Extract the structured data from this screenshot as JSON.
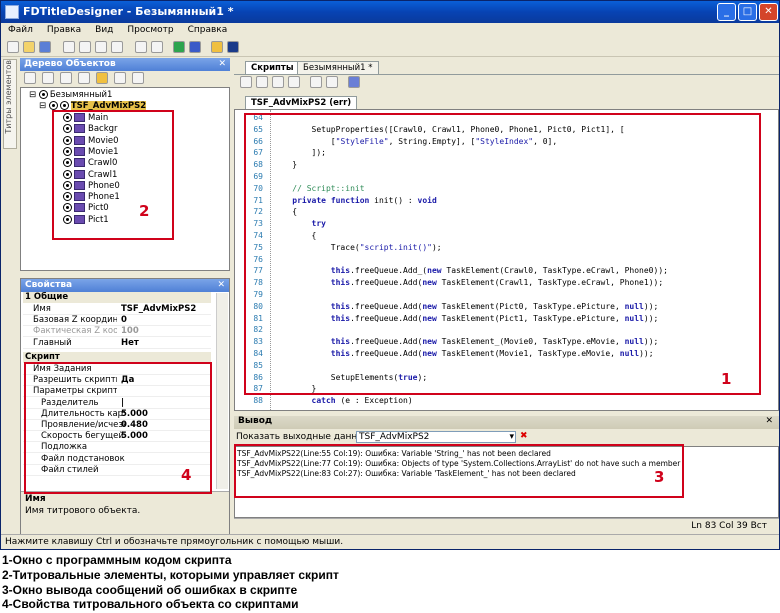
{
  "app": {
    "title": "FDTitleDesigner - Безымянный1 *"
  },
  "menu": [
    "Файл",
    "Правка",
    "Вид",
    "Просмотр",
    "Справка"
  ],
  "tree_panel": {
    "title": "Дерево Объектов",
    "side_tab": "Титры элементов",
    "root": "Безымянный1",
    "child": "TSF_AdvMixPS2",
    "items": [
      "Main",
      "Backgr",
      "Movie0",
      "Movie1",
      "Crawl0",
      "Crawl1",
      "Phone0",
      "Phone1",
      "Pict0",
      "Pict1"
    ]
  },
  "props_panel": {
    "title": "Свойства",
    "group1": "1 Общие",
    "rows1": [
      {
        "k": "Имя",
        "v": "TSF_AdvMixPS2"
      },
      {
        "k": "Базовая Z координата",
        "v": "0"
      },
      {
        "k": "Фактическая Z коорди",
        "v": "100"
      },
      {
        "k": "Главный",
        "v": "Нет"
      }
    ],
    "group2": "Скрипт",
    "rows2": [
      {
        "k": "Имя Задания",
        "v": ""
      },
      {
        "k": "Разрешить скрипты",
        "v": "Да"
      },
      {
        "k": "Параметры скрипта",
        "v": ""
      },
      {
        "k": "Разделитель",
        "v": "|"
      },
      {
        "k": "Длительность картин",
        "v": "5.000"
      },
      {
        "k": "Проявление/исчезно",
        "v": "0.480"
      },
      {
        "k": "Скорость бегущей с",
        "v": "5.000"
      },
      {
        "k": "Подложка",
        "v": ""
      },
      {
        "k": "Файл подстановок",
        "v": ""
      },
      {
        "k": "Файл стилей",
        "v": ""
      }
    ],
    "desc_title": "Имя",
    "desc_text": "Имя титрового объекта."
  },
  "editor": {
    "tabs": [
      "Скрипты",
      "Безымянный1 *"
    ],
    "file_tab": "TSF_AdvMixPS2 (err)",
    "lines": [
      {
        "n": "64",
        "t": ""
      },
      {
        "n": "65",
        "t": "        SetupProperties([Crawl0, Crawl1, Phone0, Phone1, Pict0, Pict1], ["
      },
      {
        "n": "66",
        "t": "            [\"StyleFile\", String.Empty], [\"StyleIndex\", 0],"
      },
      {
        "n": "67",
        "t": "        ]);"
      },
      {
        "n": "68",
        "t": "    }"
      },
      {
        "n": "69",
        "t": ""
      },
      {
        "n": "70",
        "t": "    // Script::init"
      },
      {
        "n": "71",
        "t": "    private function init() : void"
      },
      {
        "n": "72",
        "t": "    {"
      },
      {
        "n": "73",
        "t": "        try"
      },
      {
        "n": "74",
        "t": "        {"
      },
      {
        "n": "75",
        "t": "            Trace(\"script.init()\");"
      },
      {
        "n": "76",
        "t": ""
      },
      {
        "n": "77",
        "t": "            this.freeQueue.Add_(new TaskElement(Crawl0, TaskType.eCrawl, Phone0));"
      },
      {
        "n": "78",
        "t": "            this.freeQueue.Add(new TaskElement(Crawl1, TaskType.eCrawl, Phone1));"
      },
      {
        "n": "79",
        "t": ""
      },
      {
        "n": "80",
        "t": "            this.freeQueue.Add(new TaskElement(Pict0, TaskType.ePicture, null));"
      },
      {
        "n": "81",
        "t": "            this.freeQueue.Add(new TaskElement(Pict1, TaskType.ePicture, null));"
      },
      {
        "n": "82",
        "t": ""
      },
      {
        "n": "83",
        "t": "            this.freeQueue.Add(new TaskElement_(Movie0, TaskType.eMovie, null));"
      },
      {
        "n": "84",
        "t": "            this.freeQueue.Add(new TaskElement(Movie1, TaskType.eMovie, null));"
      },
      {
        "n": "85",
        "t": ""
      },
      {
        "n": "86",
        "t": "            SetupElements(true);"
      },
      {
        "n": "87",
        "t": "        }"
      },
      {
        "n": "88",
        "t": "        catch (e : Exception)"
      }
    ]
  },
  "output": {
    "title": "Вывод",
    "show_label": "Показать выходные данные от:",
    "source": "TSF_AdvMixPS2",
    "lines": [
      "TSF_AdvMixPS22(Line:55 Col:19): Ошибка: Variable 'String_' has not been declared",
      "TSF_AdvMixPS22(Line:77 Col:19): Ошибка: Objects of type 'System.Collections.ArrayList' do not have such a member",
      "TSF_AdvMixPS22(Line:83 Col:27): Ошибка: Variable 'TaskElement_' has not been declared"
    ]
  },
  "status": {
    "hint": "Нажмите клавишу Ctrl и обозначьте прямоугольник с помощью мыши.",
    "pos": "Ln 83  Col 39  Вст"
  },
  "callouts": [
    "1",
    "2",
    "3",
    "4"
  ],
  "legend": [
    "1-Окно с программным кодом скрипта",
    "2-Титровальные элементы, которыми управляет скрипт",
    "3-Окно вывода сообщений об ошибках в скрипте",
    "4-Свойства титровального объекта со скриптами"
  ],
  "colors": {
    "titlebar": "#0a4fc8",
    "callout": "#d0021b",
    "keyword": "#1a1aa8",
    "string": "#1a1aa8"
  }
}
